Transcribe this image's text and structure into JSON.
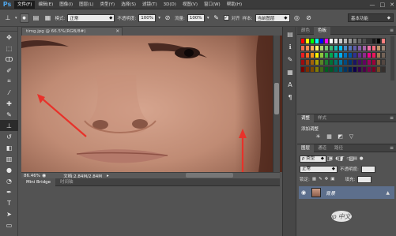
{
  "app": {
    "logo": "Ps"
  },
  "menu": [
    "文件(F)",
    "编辑(E)",
    "图像(I)",
    "图层(L)",
    "类型(Y)",
    "选择(S)",
    "滤镜(T)",
    "3D(D)",
    "视图(V)",
    "窗口(W)",
    "帮助(H)"
  ],
  "window_controls": [
    "—",
    "□",
    "✕"
  ],
  "options": {
    "mode_label": "模式:",
    "mode_value": "正常",
    "opacity_label": "不透明度:",
    "opacity_value": "100%",
    "flow_label": "流量:",
    "flow_value": "100%",
    "align_label": "对齐",
    "sample_label": "样本:",
    "sample_value": "当前图层",
    "workspace": "基本功能"
  },
  "document": {
    "tab_title": "timg.jpg @ 66.5%(RGB/8#)",
    "zoom": "86.46%",
    "doc_info": "文档:2.84M/2.84M"
  },
  "bottom_tabs": [
    "Mini Bridge",
    "时间轴"
  ],
  "swatches": {
    "tabs": [
      "颜色",
      "色板"
    ],
    "colors": [
      "#ff0000",
      "#ffff00",
      "#00ff00",
      "#00ffff",
      "#0000ff",
      "#ff00ff",
      "#ffffff",
      "#e5e5e5",
      "#cccccc",
      "#b3b3b3",
      "#999999",
      "#808080",
      "#666666",
      "#4d4d4d",
      "#333333",
      "#1a1a1a",
      "#000000",
      "#ff8080",
      "#f26c4f",
      "#f68e55",
      "#fbaf5c",
      "#fff467",
      "#acd372",
      "#7cc576",
      "#3bb878",
      "#1abbb4",
      "#00bff3",
      "#438ccb",
      "#5574b9",
      "#605ca8",
      "#855fa8",
      "#a763a8",
      "#f06ea9",
      "#f26d7d",
      "#c1976c",
      "#998675",
      "#ed1c24",
      "#f26522",
      "#f7941d",
      "#fff200",
      "#8dc63f",
      "#39b54a",
      "#00a651",
      "#00a99d",
      "#00aeef",
      "#0072bc",
      "#0054a6",
      "#2e3192",
      "#662d91",
      "#92278f",
      "#ec008c",
      "#ed145b",
      "#a67c52",
      "#736357",
      "#9e0b0f",
      "#a0410d",
      "#a36209",
      "#aba000",
      "#598527",
      "#1a7b30",
      "#007236",
      "#00746b",
      "#0076a3",
      "#004b80",
      "#003471",
      "#1b1464",
      "#440e62",
      "#630460",
      "#9e005d",
      "#9e0039",
      "#8c6239",
      "#534741",
      "#790000",
      "#7b2e00",
      "#7d4900",
      "#827b00",
      "#406618",
      "#005e20",
      "#005826",
      "#005952",
      "#005b7f",
      "#003663",
      "#002157",
      "#0d004c",
      "#32004b",
      "#4b0049",
      "#7b0046",
      "#7a0026",
      "#754c24",
      "#362f2d"
    ]
  },
  "adjustments": {
    "tabs": [
      "调整",
      "样式"
    ],
    "title": "添加调整",
    "row1": [
      "☀",
      "▦",
      "◩",
      "▽"
    ],
    "row2": [
      "⚖",
      "◐",
      "▣",
      "☐",
      "◒",
      "▥"
    ],
    "row3": [
      "◪",
      "◫",
      "◨",
      "▨"
    ]
  },
  "layers": {
    "tabs": [
      "图层",
      "通道",
      "路径"
    ],
    "kind_label": "ρ 类型",
    "blend_mode": "正常",
    "opacity_label": "不透明度:",
    "lock_label": "锁定:",
    "fill_label": "填充:",
    "layer_name": "背景",
    "lock_icon": "🔒"
  },
  "watermark": "php 中文网"
}
